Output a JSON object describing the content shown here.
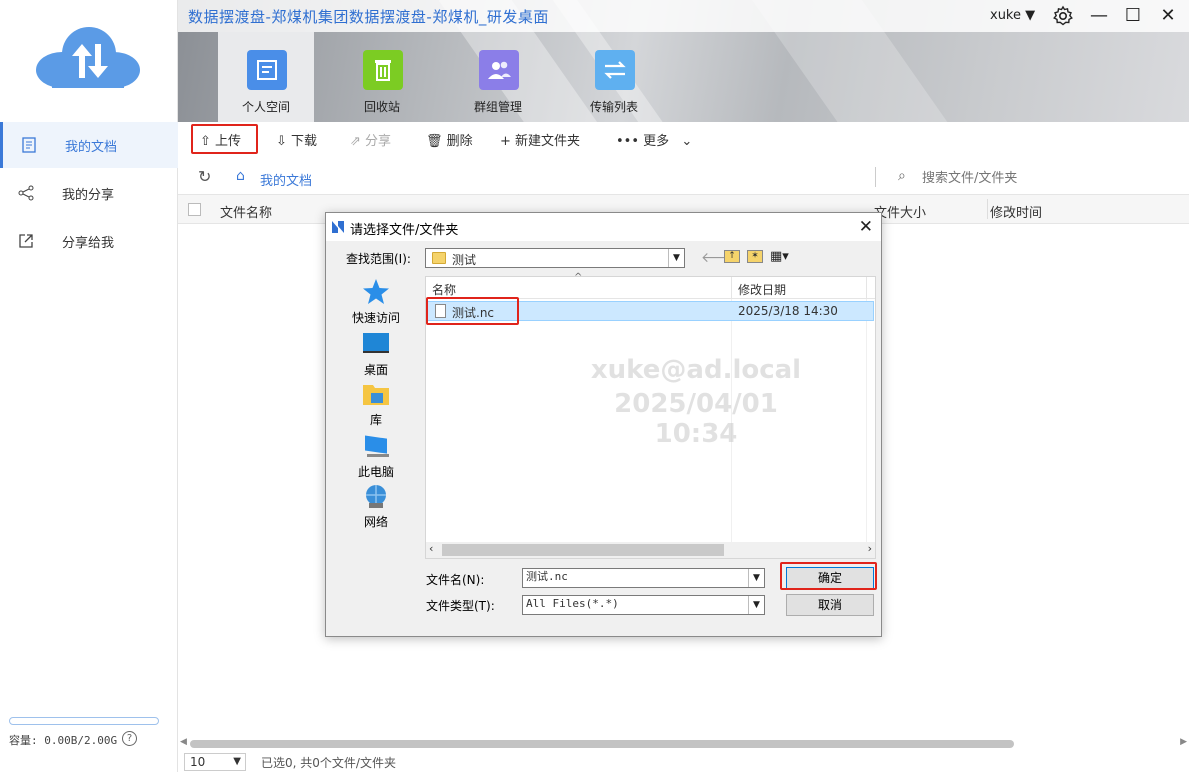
{
  "app": {
    "title": "数据摆渡盘-郑煤机集团数据摆渡盘-郑煤机_研发桌面",
    "user": "xuke",
    "colors": {
      "accent": "#3b79d8",
      "highlight": "#e0241b"
    }
  },
  "tiles": [
    {
      "label": "个人空间",
      "icon": "document-icon",
      "color": "#4a8ee8"
    },
    {
      "label": "回收站",
      "icon": "trash-icon",
      "color": "#7ccc23"
    },
    {
      "label": "群组管理",
      "icon": "group-icon",
      "color": "#8b7ee8"
    },
    {
      "label": "传输列表",
      "icon": "transfer-icon",
      "color": "#5fb0f0"
    }
  ],
  "sidebar": {
    "items": [
      {
        "label": "我的文档",
        "icon": "document-icon"
      },
      {
        "label": "我的分享",
        "icon": "share-icon"
      },
      {
        "label": "分享给我",
        "icon": "external-link-icon"
      }
    ],
    "quota_text": "容量: 0.00B/2.00G",
    "quota_used": 0
  },
  "toolbar": {
    "upload": "上传",
    "download": "下载",
    "share": "分享",
    "delete": "删除",
    "new_folder": "新建文件夹",
    "more": "更多"
  },
  "path": {
    "current": "我的文档",
    "search_placeholder": "搜索文件/文件夹"
  },
  "columns": {
    "name": "文件名称",
    "size": "文件大小",
    "modified": "修改时间"
  },
  "footer": {
    "page_size": "10",
    "status": "已选0, 共0个文件/文件夹"
  },
  "dialog": {
    "title": "请选择文件/文件夹",
    "look_in_label": "查找范围(I):",
    "look_in_value": "测试",
    "places": [
      "快速访问",
      "桌面",
      "库",
      "此电脑",
      "网络"
    ],
    "headers": {
      "name": "名称",
      "modified": "修改日期"
    },
    "files": [
      {
        "name": "测试.nc",
        "modified": "2025/3/18 14:30"
      }
    ],
    "filename_label": "文件名(N):",
    "filename_value": "测试.nc",
    "filetype_label": "文件类型(T):",
    "filetype_value": "All Files(*.*)",
    "ok": "确定",
    "cancel": "取消",
    "watermark_user": "xuke@ad.local",
    "watermark_time": "2025/04/01 10:34"
  }
}
